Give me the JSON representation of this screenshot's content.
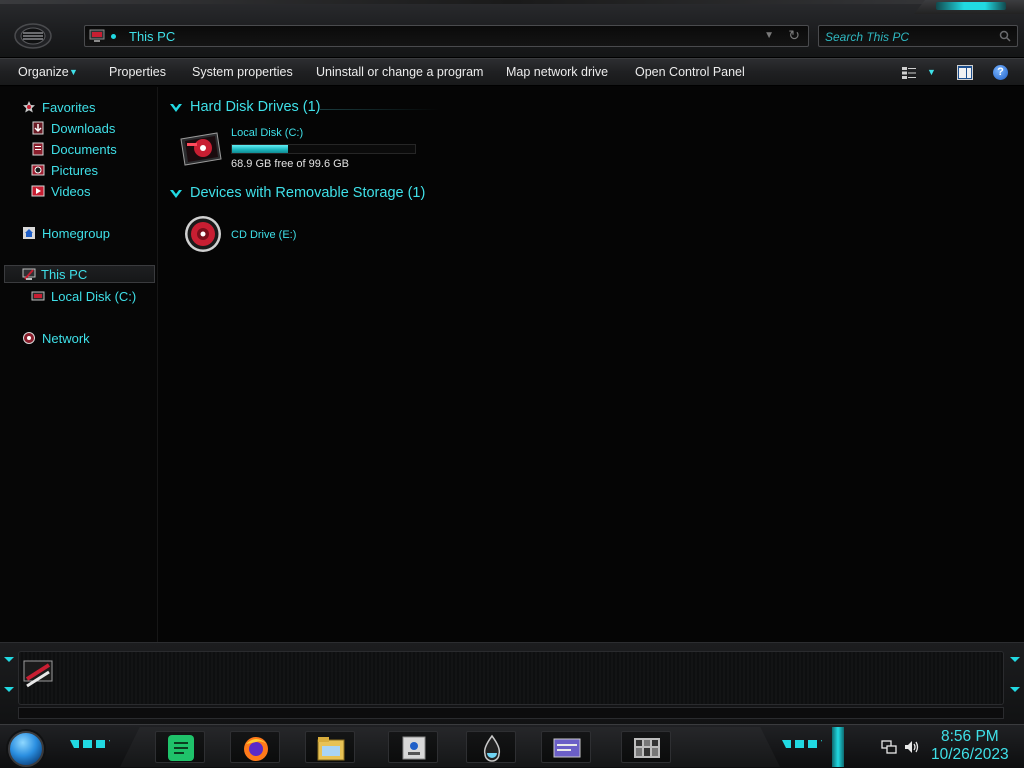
{
  "address_bar": {
    "path": "This PC",
    "search_placeholder": "Search This PC"
  },
  "command_bar": {
    "organize": "Organize",
    "properties": "Properties",
    "system_properties": "System properties",
    "uninstall": "Uninstall or change a program",
    "map_drive": "Map network drive",
    "control_panel": "Open Control Panel"
  },
  "nav_pane": {
    "favorites": "Favorites",
    "downloads": "Downloads",
    "documents": "Documents",
    "pictures": "Pictures",
    "videos": "Videos",
    "homegroup": "Homegroup",
    "this_pc": "This PC",
    "local_disk": "Local Disk (C:)",
    "network": "Network"
  },
  "content": {
    "hard_disk_group": "Hard Disk Drives (1)",
    "removable_group": "Devices with Removable Storage (1)",
    "local_disk": {
      "name": "Local Disk (C:)",
      "free_text": "68.9 GB free of 99.6 GB",
      "used_fraction": 0.308
    },
    "cd_drive": {
      "name": "CD Drive (E:)"
    }
  },
  "taskbar": {
    "apps": [
      "spreadsheet-app-icon",
      "firefox-icon",
      "file-explorer-icon",
      "id-card-icon",
      "water-drop-icon",
      "window-card-icon",
      "photo-grid-icon"
    ],
    "clock_time": "8:56 PM",
    "clock_date": "10/26/2023"
  },
  "colors": {
    "accent": "#21d9e2",
    "text_accent": "#3fe0e8",
    "background": "#050505",
    "drive_red": "#c81e32"
  }
}
